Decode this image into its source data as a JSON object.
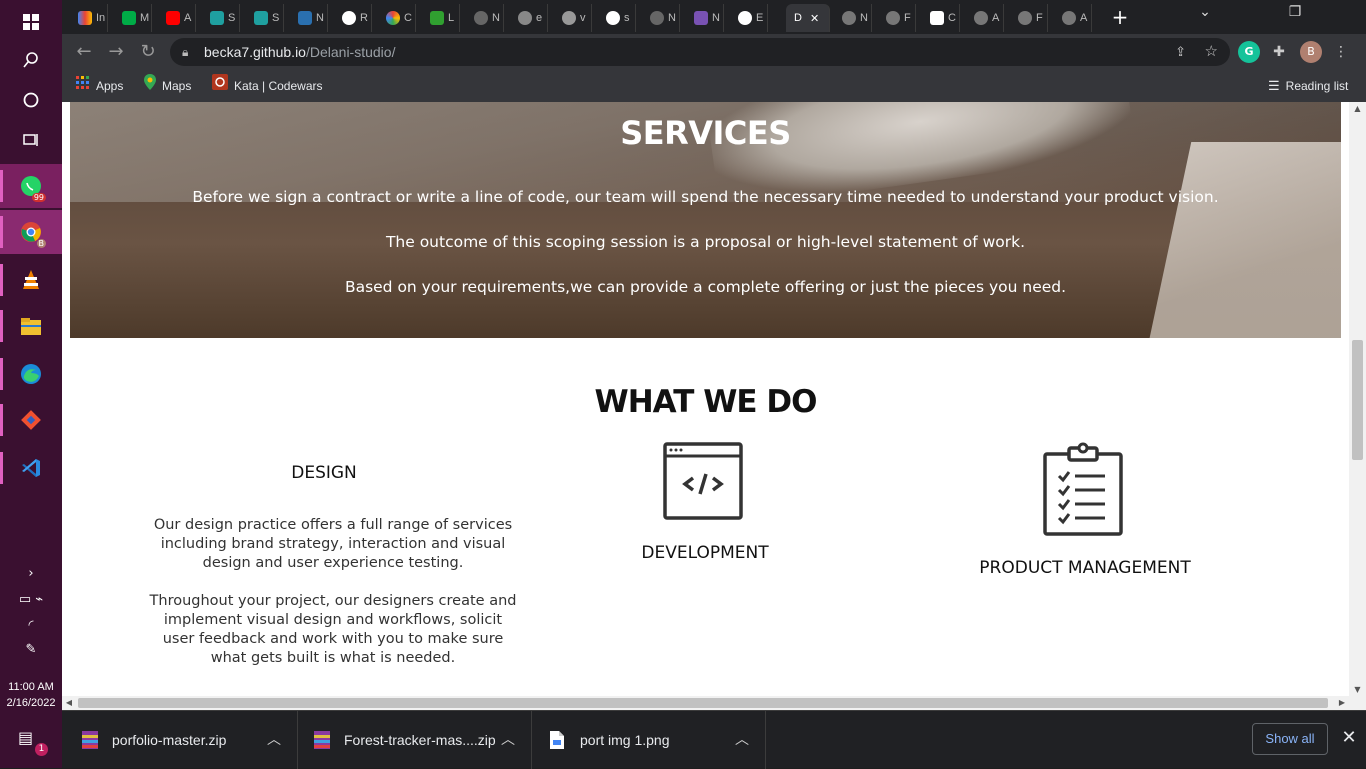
{
  "taskbar": {
    "start_icon": "windows-icon",
    "search_icon": "search-icon",
    "cortana_icon": "circle-icon",
    "taskview_icon": "task-view-icon",
    "apps": [
      {
        "name": "whatsapp",
        "badge": "99"
      },
      {
        "name": "chrome",
        "badge": "B"
      },
      {
        "name": "vlc",
        "badge": ""
      },
      {
        "name": "file-explorer",
        "badge": ""
      },
      {
        "name": "edge",
        "badge": ""
      },
      {
        "name": "git",
        "badge": ""
      },
      {
        "name": "vscode",
        "badge": ""
      }
    ],
    "time": "11:00 AM",
    "date": "2/16/2022",
    "notifications": "1"
  },
  "browser": {
    "tab_labels": [
      "In",
      "M",
      "A",
      "S",
      "S",
      "N",
      "R",
      "C",
      "L",
      "N",
      "e",
      "v",
      "s",
      "N",
      "N",
      "E",
      "D",
      "N",
      "F",
      "C",
      "A",
      "F",
      "A"
    ],
    "active_tab_label": "D",
    "url_host": "becka7.github.io",
    "url_path": "/Delani-studio/",
    "bookmarks": [
      {
        "label": "Apps",
        "icon": "apps-grid-icon"
      },
      {
        "label": "Maps",
        "icon": "maps-pin-icon"
      },
      {
        "label": "Kata | Codewars",
        "icon": "codewars-icon"
      }
    ],
    "reading_list": "Reading list",
    "profile_initial": "B",
    "grammarly": "G"
  },
  "page": {
    "services": {
      "title": "SERVICES",
      "paragraphs": [
        "Before we sign a contract or write a line of code, our team will spend the necessary time needed to understand your product vision.",
        "The outcome of this scoping session is a proposal or high-level statement of work.",
        "Based on your requirements,we can provide a complete offering or just the pieces you need."
      ]
    },
    "what_we_do": {
      "title": "WHAT WE DO",
      "design": {
        "title": "DESIGN",
        "text1": "Our design practice offers a full range of services including brand strategy, interaction and visual design and user experience testing.",
        "text2": "Throughout your project, our designers create and implement visual design and workflows, solicit user feedback and work with you to make sure what gets built is what is needed."
      },
      "development": {
        "title": "DEVELOPMENT",
        "icon": "code-window-icon"
      },
      "product": {
        "title": "PRODUCT MANAGEMENT",
        "icon": "clipboard-checklist-icon"
      }
    }
  },
  "downloads": {
    "items": [
      "porfolio-master.zip",
      "Forest-tracker-mas....zip",
      "port img 1.png"
    ],
    "show_all": "Show all"
  }
}
